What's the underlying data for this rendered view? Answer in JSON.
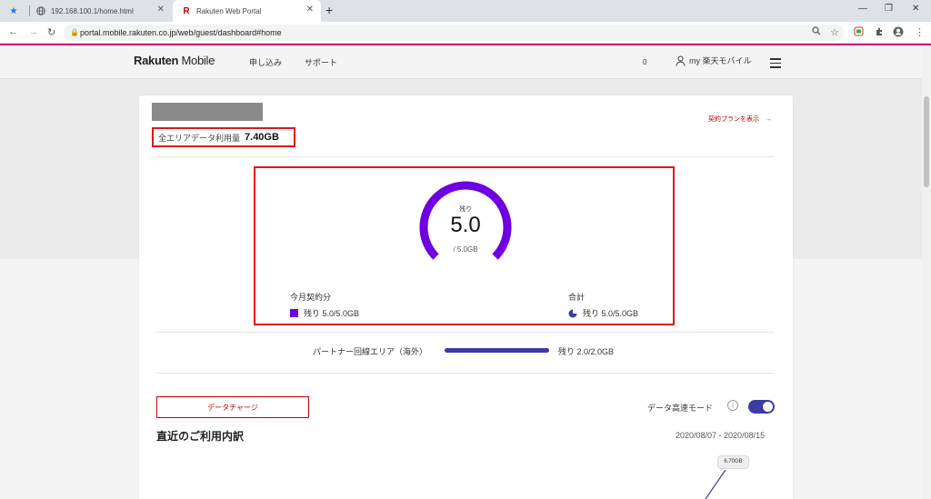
{
  "browser": {
    "tabs": [
      {
        "title": "192.168.100.1/home.html"
      },
      {
        "title": "Rakuten Web Portal"
      }
    ],
    "url": "portal.mobile.rakuten.co.jp/web/guest/dashboard#home",
    "pinned_icon": "star-icon"
  },
  "header": {
    "logo_bold": "Rakuten",
    "logo_light": " Mobile",
    "nav": [
      "申し込み",
      "サポート"
    ],
    "count": "0",
    "user_label": "my 楽天モバイル"
  },
  "summary": {
    "usage_label": "全エリアデータ利用量",
    "usage_value": "7.40GB",
    "plan_link": "契約プランを表示　→"
  },
  "gauge": {
    "remain_label": "残り",
    "value": "5.0",
    "total": "/ 5.0GB",
    "fraction_remaining": 1.0,
    "color": "#6f00e0"
  },
  "legend": {
    "monthly_title": "今月契約分",
    "monthly_value": "残り 5.0/5.0GB",
    "total_title": "合計",
    "total_value": "残り 5.0/5.0GB"
  },
  "partner": {
    "label": "パートナー回線エリア（海外）",
    "value": "残り 2.0/2.0GB",
    "fraction_remaining": 1.0,
    "color": "#3d3aa6"
  },
  "actions": {
    "charge_button": "データチャージ",
    "speed_mode_label": "データ高速モード",
    "speed_mode_on": true
  },
  "recent": {
    "title": "直近のご利用内訳",
    "date_range": "2020/08/07 - 2020/08/15",
    "bubble_value": "6.70GB"
  }
}
